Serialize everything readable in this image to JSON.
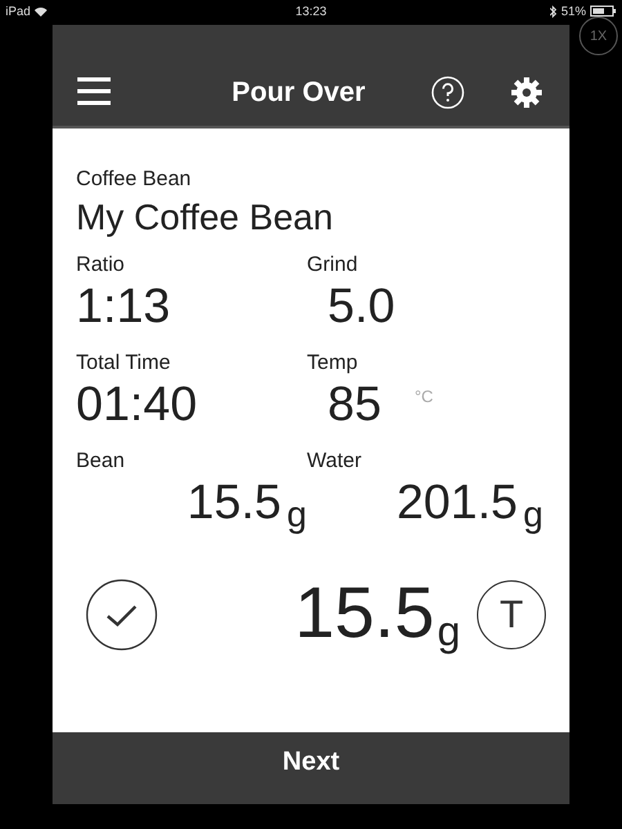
{
  "status_bar": {
    "device": "iPad",
    "time": "13:23",
    "battery": "51%"
  },
  "zoom_button": "1X",
  "header": {
    "title": "Pour Over"
  },
  "coffee_bean": {
    "label": "Coffee Bean",
    "value": "My Coffee Bean"
  },
  "fields": [
    {
      "kind": "text",
      "label": "Ratio",
      "value": "1:13"
    },
    {
      "kind": "number",
      "label": "Grind",
      "value": "5.0"
    },
    {
      "kind": "text",
      "label": "Total Time",
      "value": "01:40"
    },
    {
      "kind": "temp",
      "label": "Temp",
      "value": "85",
      "unit": "°C"
    },
    {
      "kind": "weight",
      "label": "Bean",
      "value": "15.5",
      "unit": "g"
    },
    {
      "kind": "weight",
      "label": "Water",
      "value": "201.5",
      "unit": "g"
    }
  ],
  "scale": {
    "reading": "15.5",
    "unit": "g",
    "tare_label": "T"
  },
  "next_button": "Next"
}
